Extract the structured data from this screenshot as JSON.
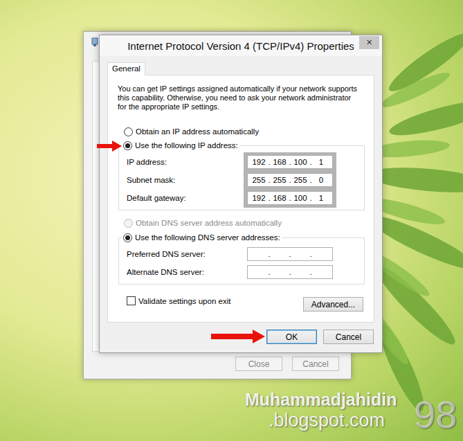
{
  "window": {
    "title": "Internet Protocol Version 4 (TCP/IPv4) Properties",
    "close_glyph": "✕"
  },
  "tabs": [
    {
      "label": "General",
      "selected": true
    }
  ],
  "intro": "You can get IP settings assigned automatically if your network supports this capability. Otherwise, you need to ask your network administrator for the appropriate IP settings.",
  "ip_section": {
    "auto_option": {
      "label": "Obtain an IP address automatically",
      "selected": false,
      "disabled": false
    },
    "manual_option": {
      "label": "Use the following IP address:",
      "selected": true,
      "disabled": false
    },
    "fields": [
      {
        "label": "IP address:",
        "octets": [
          "192",
          "168",
          "100",
          "1"
        ]
      },
      {
        "label": "Subnet mask:",
        "octets": [
          "255",
          "255",
          "255",
          "0"
        ]
      },
      {
        "label": "Default gateway:",
        "octets": [
          "192",
          "168",
          "100",
          "1"
        ]
      }
    ]
  },
  "dns_section": {
    "auto_option": {
      "label": "Obtain DNS server address automatically",
      "selected": false,
      "disabled": true
    },
    "manual_option": {
      "label": "Use the following DNS server addresses:",
      "selected": true,
      "disabled": false
    },
    "fields": [
      {
        "label": "Preferred DNS server:",
        "octets": [
          "",
          "",
          "",
          ""
        ]
      },
      {
        "label": "Alternate DNS server:",
        "octets": [
          "",
          "",
          "",
          ""
        ]
      }
    ]
  },
  "octet_separator": ".",
  "validate": {
    "label": "Validate settings upon exit",
    "checked": false
  },
  "advanced_button": "Advanced...",
  "buttons": [
    {
      "label": "OK",
      "focused": true
    },
    {
      "label": "Cancel",
      "focused": false
    }
  ],
  "back_window": {
    "buttons": [
      {
        "label": "Close",
        "disabled": true
      },
      {
        "label": "Cancel",
        "disabled": true
      }
    ]
  },
  "watermark": {
    "line1": "Muhammadjahidin",
    "line2": ".blogspot.com",
    "number": "98"
  }
}
